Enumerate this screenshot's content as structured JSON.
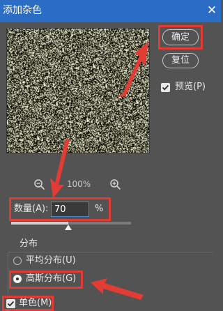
{
  "window": {
    "title": "添加杂色",
    "close_glyph": "✕"
  },
  "preview": {
    "zoom_level": "100%",
    "zoom_out_icon": "zoom-out-icon",
    "zoom_in_icon": "zoom-in-icon"
  },
  "buttons": {
    "ok_label": "确定",
    "reset_label": "复位"
  },
  "preview_checkbox": {
    "label": "预览(P)",
    "checked": true
  },
  "amount": {
    "label": "数量(A):",
    "value": "70",
    "unit": "%",
    "slider_fraction": 0.475
  },
  "distribution": {
    "group_label": "分布",
    "options": [
      {
        "label": "平均分布(U)",
        "selected": false
      },
      {
        "label": "高斯分布(G)",
        "selected": true
      }
    ]
  },
  "monochromatic": {
    "label": "单色(M)",
    "checked": true
  },
  "colors": {
    "title_bar": "#2b6cc4",
    "dialog_bg": "#535353",
    "annotation_red": "#e23c34",
    "input_focus": "#3c8bd9"
  }
}
